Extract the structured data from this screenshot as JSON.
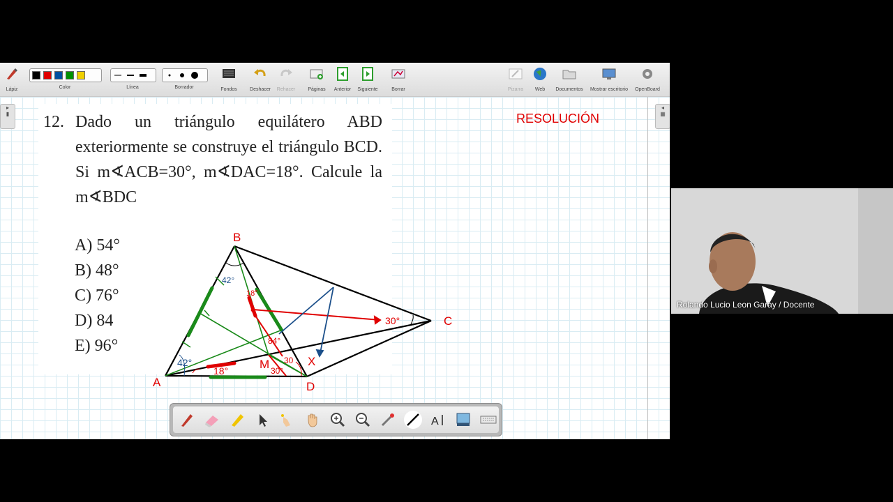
{
  "toolbar": {
    "lapiz": "Lápiz",
    "color": "Color",
    "linea": "Línea",
    "borrador": "Borrador",
    "fondos": "Fondos",
    "deshacer": "Deshacer",
    "rehacer": "Rehacer",
    "paginas": "Páginas",
    "anterior": "Anterior",
    "siguiente": "Siguiente",
    "borrar": "Borrar",
    "pizarra": "Pizarra",
    "web": "Web",
    "documentos": "Documentos",
    "mostrar_escritorio": "Mostrar escritorio",
    "openboard": "OpenBoard",
    "colors": [
      "#000000",
      "#e00000",
      "#0050a0",
      "#009000",
      "#f0d000"
    ]
  },
  "problem": {
    "number": "12.",
    "text": "Dado un triángulo equilátero ABD exteriormente se construye el triángulo BCD. Si m∢ACB=30°, m∢DAC=18°. Calcule la m∢BDC",
    "options": [
      "A) 54°",
      "B) 48°",
      "C) 76°",
      "D) 84",
      "E) 96°"
    ]
  },
  "resolution_label": "RESOLUCIÓN",
  "figure": {
    "points": {
      "A": "A",
      "B": "B",
      "C": "C",
      "D": "D",
      "M": "M",
      "X": "X"
    },
    "angles": {
      "acb": "30°",
      "dac": "18°",
      "a42": "42°",
      "b42": "42°",
      "b18": "18°",
      "m84": "84°",
      "m30": "30°",
      "x30": "30"
    }
  },
  "video": {
    "name": "Rolando Lucio Leon Garay / Docente"
  }
}
